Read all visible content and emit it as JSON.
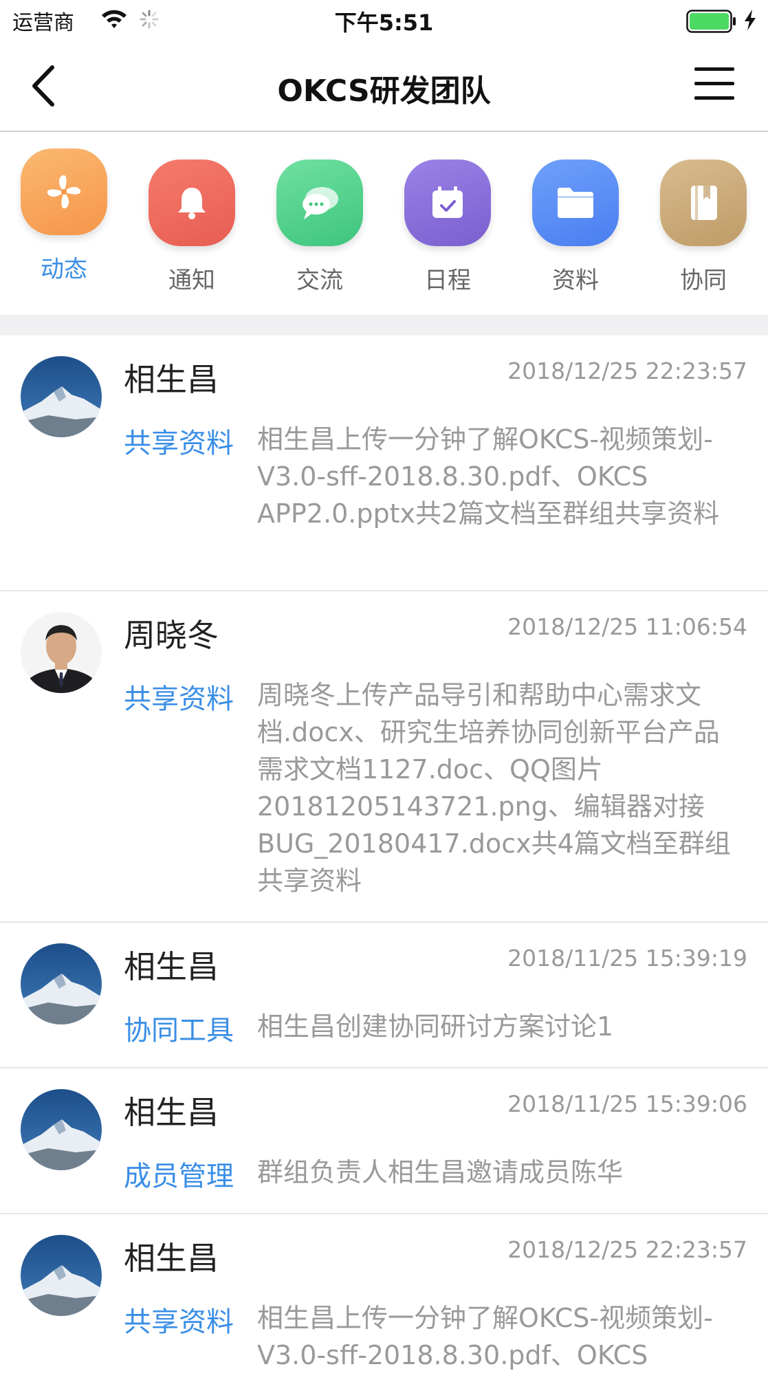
{
  "status_bar": {
    "carrier": "运营商",
    "time": "下午5:51",
    "battery_color": "#4cd964"
  },
  "nav": {
    "title": "OKCS研发团队",
    "back_icon": "chevron-left-icon",
    "menu_icon": "hamburger-menu-icon"
  },
  "categories": [
    {
      "label": "动态",
      "icon": "pinwheel-icon",
      "color": "#f7a45a",
      "active": true
    },
    {
      "label": "通知",
      "icon": "bell-icon",
      "color": "#ee6a5f"
    },
    {
      "label": "交流",
      "icon": "chat-bubbles-icon",
      "color": "#4fcf8b"
    },
    {
      "label": "日程",
      "icon": "calendar-check-icon",
      "color": "#8a6fd8"
    },
    {
      "label": "资料",
      "icon": "folder-icon",
      "color": "#5b8df5"
    },
    {
      "label": "协同",
      "icon": "book-icon",
      "color": "#c8a877"
    }
  ],
  "feed": [
    {
      "name": "相生昌",
      "time": "2018/12/25 22:23:57",
      "tag": "共享资料",
      "desc": "相生昌上传一分钟了解OKCS-视频策划-V3.0-sff-2018.8.30.pdf、OKCS APP2.0.pptx共2篇文档至群组共享资料",
      "avatar": "mountain"
    },
    {
      "name": "周晓冬",
      "time": "2018/12/25 11:06:54",
      "tag": "共享资料",
      "desc": "周晓冬上传产品导引和帮助中心需求文档.docx、研究生培养协同创新平台产品需求文档1127.doc、QQ图片20181205143721.png、编辑器对接BUG_20180417.docx共4篇文档至群组共享资料",
      "avatar": "person"
    },
    {
      "name": "相生昌",
      "time": "2018/11/25 15:39:19",
      "tag": "协同工具",
      "desc": "相生昌创建协同研讨方案讨论1",
      "avatar": "mountain"
    },
    {
      "name": "相生昌",
      "time": "2018/11/25 15:39:06",
      "tag": "成员管理",
      "desc": "群组负责人相生昌邀请成员陈华",
      "avatar": "mountain"
    },
    {
      "name": "相生昌",
      "time": "2018/12/25 22:23:57",
      "tag": "共享资料",
      "desc": "相生昌上传一分钟了解OKCS-视频策划-V3.0-sff-2018.8.30.pdf、OKCS",
      "avatar": "mountain"
    }
  ]
}
